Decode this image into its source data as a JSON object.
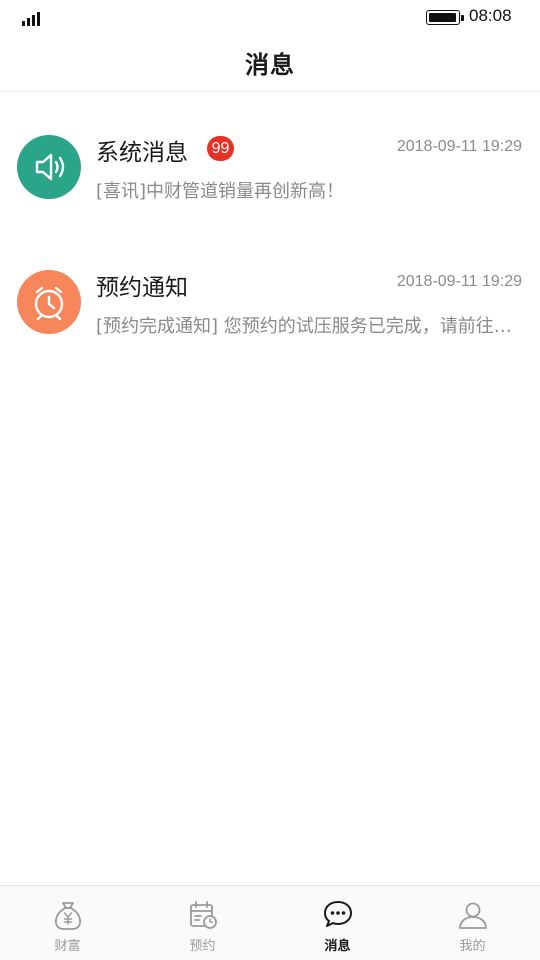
{
  "status_bar": {
    "time": "08:08",
    "signal_icon": "signal-bars-icon",
    "battery_icon": "battery-icon"
  },
  "header": {
    "title": "消息"
  },
  "messages": [
    {
      "title": "系统消息",
      "badge": "99",
      "time": "2018-09-11 19:29",
      "preview": "[喜讯]中财管道销量再创新高！",
      "icon": "speaker-icon",
      "icon_color": "#2aa58a"
    },
    {
      "title": "预约通知",
      "time": "2018-09-11 19:29",
      "preview": "[预约完成通知] 您预约的试压服务已完成，请前往查看服务详情",
      "icon": "alarm-clock-icon",
      "icon_color": "#f7875a"
    }
  ],
  "tabs": [
    {
      "label": "财富",
      "icon": "money-bag-icon",
      "active": false
    },
    {
      "label": "预约",
      "icon": "calendar-clock-icon",
      "active": false
    },
    {
      "label": "消息",
      "icon": "chat-bubble-icon",
      "active": true
    },
    {
      "label": "我的",
      "icon": "user-icon",
      "active": false
    }
  ],
  "colors": {
    "badge": "#e63127",
    "tab_inactive": "#9b9b9b",
    "tab_active": "#1a1a1a"
  }
}
